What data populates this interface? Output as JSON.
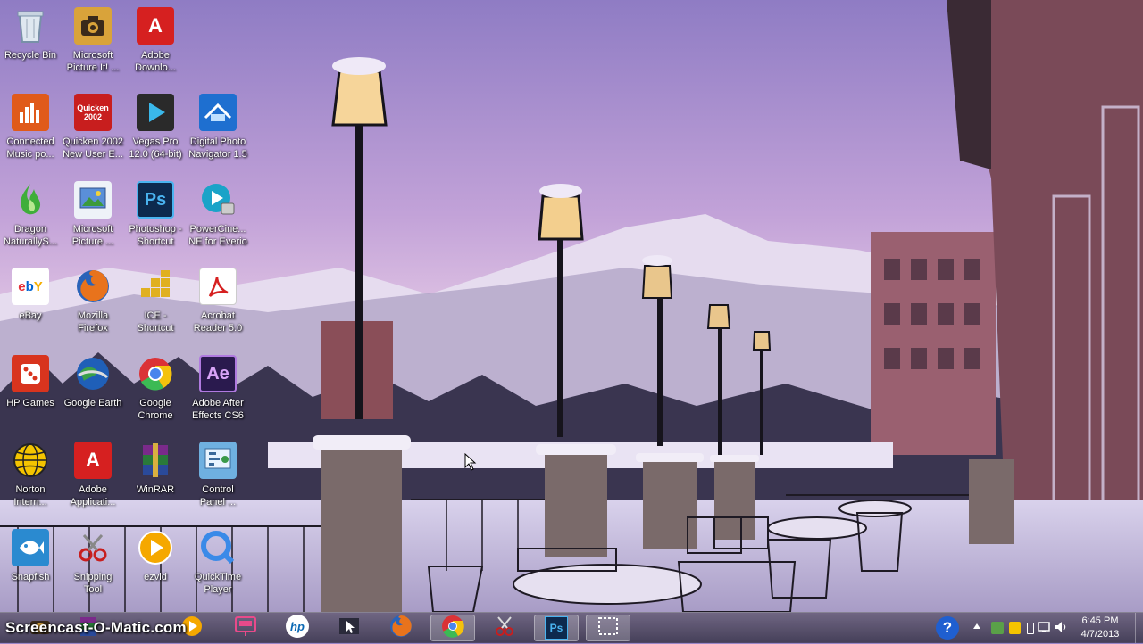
{
  "desktop": {
    "icons": [
      {
        "label": "Recycle Bin",
        "icon": "recycle-bin-icon",
        "color": "#c9d6e3"
      },
      {
        "label": "Microsoft\nPicture It! ...",
        "icon": "camera-icon",
        "color": "#d9a33a"
      },
      {
        "label": "Adobe\nDownlo...",
        "icon": "adobe-icon",
        "color": "#d62020"
      },
      {
        "label": "Connected\nMusic po...",
        "icon": "equalizer-icon",
        "color": "#e05a1a"
      },
      {
        "label": "Quicken 2002\nNew User E...",
        "icon": "quicken-icon",
        "color": "#c81e1e"
      },
      {
        "label": "Vegas Pro\n12.0 (64-bit)",
        "icon": "play-icon",
        "color": "#2a2a2a"
      },
      {
        "label": "Digital Photo\nNavigator 1.5",
        "icon": "photo-navigator-icon",
        "color": "#1e6fd0"
      },
      {
        "label": "Dragon\nNaturallyS...",
        "icon": "dragon-flame-icon",
        "color": "#3fae3a"
      },
      {
        "label": "Microsoft\nPicture ...",
        "icon": "picture-icon",
        "color": "#5a8fd8"
      },
      {
        "label": "Photoshop -\nShortcut",
        "icon": "photoshop-icon",
        "color": "#0d2a4e"
      },
      {
        "label": "PowerCine...\nNE for Everio",
        "icon": "powercinema-icon",
        "color": "#1aa3c8"
      },
      {
        "label": "eBay",
        "icon": "ebay-icon",
        "color": "#ffffff"
      },
      {
        "label": "Mozilla\nFirefox",
        "icon": "firefox-icon",
        "color": "#e8731c"
      },
      {
        "label": "ICE -\nShortcut",
        "icon": "ice-icon",
        "color": "#e0b020"
      },
      {
        "label": "Acrobat\nReader 5.0",
        "icon": "acrobat-icon",
        "color": "#ffffff"
      },
      {
        "label": "HP Games",
        "icon": "dice-icon",
        "color": "#d8341e"
      },
      {
        "label": "Google Earth",
        "icon": "globe-icon",
        "color": "#1f5fb8"
      },
      {
        "label": "Google\nChrome",
        "icon": "chrome-icon",
        "color": "#f2f2f2"
      },
      {
        "label": "Adobe After\nEffects CS6",
        "icon": "after-effects-icon",
        "color": "#2a1a4e"
      },
      {
        "label": "Norton\nIntern...",
        "icon": "norton-globe-icon",
        "color": "#f4c400"
      },
      {
        "label": "Adobe\nApplicati...",
        "icon": "adobe-icon",
        "color": "#d62020"
      },
      {
        "label": "WinRAR",
        "icon": "winrar-icon",
        "color": "#7a2a8a"
      },
      {
        "label": "Control\nPanel ...",
        "icon": "control-panel-icon",
        "color": "#6fb0e0"
      },
      {
        "label": "Snapfish",
        "icon": "fish-icon",
        "color": "#2a8ad0"
      },
      {
        "label": "Snipping\nTool",
        "icon": "scissors-icon",
        "color": "#e8e8e8"
      },
      {
        "label": "ezvid",
        "icon": "ezvid-play-icon",
        "color": "#f5a800"
      },
      {
        "label": "QuickTime\nPlayer",
        "icon": "quicktime-icon",
        "color": "#3a8ae8"
      }
    ]
  },
  "icon_text": {
    "adobe": "A",
    "quicken": "Quicken 2002",
    "photoshop": "Ps",
    "ebay": "ebY",
    "after_effects": "Ae",
    "hp": "hp",
    "ps_taskbar": "Ps"
  },
  "watermark": "Screencast-O-Matic.com",
  "taskbar": {
    "buttons": [
      {
        "icon": "camera-icon",
        "active": false
      },
      {
        "icon": "winrar-icon",
        "active": false
      },
      {
        "icon": "ezvid-play-icon",
        "active": false
      },
      {
        "icon": "presentation-icon",
        "active": false
      },
      {
        "icon": "hp-icon",
        "active": false
      },
      {
        "icon": "cursor-tool-icon",
        "active": false
      },
      {
        "icon": "firefox-icon",
        "active": false
      },
      {
        "icon": "chrome-icon",
        "active": true
      },
      {
        "icon": "snipping-tool-icon",
        "active": false
      },
      {
        "icon": "photoshop-icon",
        "active": true
      },
      {
        "icon": "screen-capture-icon",
        "active": true
      }
    ],
    "tray": {
      "clock_time": "6:45 PM",
      "clock_date": "4/7/2013",
      "icons": [
        "help-icon",
        "show-hidden-icons-icon",
        "network-tool-icon",
        "security-icon",
        "battery-icon",
        "wifi-icon",
        "speaker-icon"
      ]
    }
  }
}
